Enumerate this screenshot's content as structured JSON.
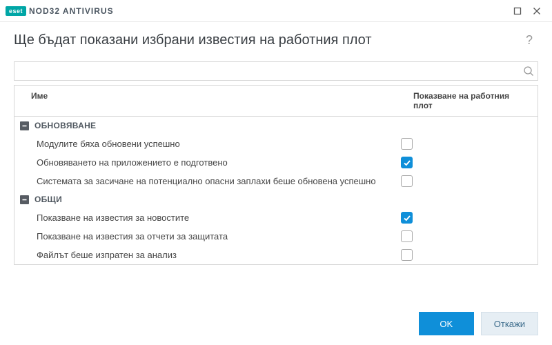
{
  "titlebar": {
    "logo_badge": "eset",
    "logo_text": "NOD32 ANTIVIRUS"
  },
  "header": {
    "title": "Ще бъдат показани избрани известия на работния плот",
    "help": "?"
  },
  "search": {
    "placeholder": ""
  },
  "table": {
    "columns": {
      "name": "Име",
      "desktop": "Показване на работния плот"
    },
    "groups": [
      {
        "label": "ОБНОВЯВАНЕ",
        "items": [
          {
            "label": "Модулите бяха обновени успешно",
            "checked": false
          },
          {
            "label": "Обновяването на приложението е подготвено",
            "checked": true
          },
          {
            "label": "Системата за засичане на потенциално опасни заплахи беше обновена успешно",
            "checked": false
          }
        ]
      },
      {
        "label": "ОБЩИ",
        "items": [
          {
            "label": "Показване на известия за новостите",
            "checked": true
          },
          {
            "label": "Показване на известия за отчети за защитата",
            "checked": false
          },
          {
            "label": "Файлът беше изпратен за анализ",
            "checked": false
          }
        ]
      }
    ]
  },
  "footer": {
    "ok": "OK",
    "cancel": "Откажи"
  }
}
